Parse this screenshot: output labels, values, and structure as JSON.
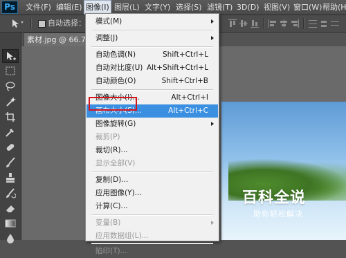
{
  "app": {
    "logo": "Ps"
  },
  "menubar": {
    "items": [
      {
        "label": "文件(F)"
      },
      {
        "label": "编辑(E)"
      },
      {
        "label": "图像(I)"
      },
      {
        "label": "图层(L)"
      },
      {
        "label": "文字(Y)"
      },
      {
        "label": "选择(S)"
      },
      {
        "label": "滤镜(T)"
      },
      {
        "label": "3D(D)"
      },
      {
        "label": "视图(V)"
      },
      {
        "label": "窗口(W)"
      },
      {
        "label": "帮助(H)"
      }
    ],
    "active_index": 2
  },
  "options_bar": {
    "auto_select_label": "自动选择："
  },
  "document": {
    "tab_label": "素材.jpg @ 66.7%"
  },
  "image_menu": {
    "items": [
      {
        "label": "模式(M)",
        "shortcut": "",
        "submenu": true,
        "disabled": false
      },
      {
        "label": "调整(J)",
        "shortcut": "",
        "submenu": true,
        "disabled": false
      },
      {
        "label": "自动色调(N)",
        "shortcut": "Shift+Ctrl+L",
        "submenu": false,
        "disabled": false
      },
      {
        "label": "自动对比度(U)",
        "shortcut": "Alt+Shift+Ctrl+L",
        "submenu": false,
        "disabled": false
      },
      {
        "label": "自动颜色(O)",
        "shortcut": "Shift+Ctrl+B",
        "submenu": false,
        "disabled": false
      },
      {
        "label": "图像大小(I)...",
        "shortcut": "Alt+Ctrl+I",
        "submenu": false,
        "disabled": false
      },
      {
        "label": "画布大小(S)...",
        "shortcut": "Alt+Ctrl+C",
        "submenu": false,
        "disabled": false,
        "highlighted": true
      },
      {
        "label": "图像旋转(G)",
        "shortcut": "",
        "submenu": true,
        "disabled": false
      },
      {
        "label": "裁剪(P)",
        "shortcut": "",
        "submenu": false,
        "disabled": true
      },
      {
        "label": "裁切(R)...",
        "shortcut": "",
        "submenu": false,
        "disabled": false
      },
      {
        "label": "显示全部(V)",
        "shortcut": "",
        "submenu": false,
        "disabled": true
      },
      {
        "label": "复制(D)...",
        "shortcut": "",
        "submenu": false,
        "disabled": false
      },
      {
        "label": "应用图像(Y)...",
        "shortcut": "",
        "submenu": false,
        "disabled": false
      },
      {
        "label": "计算(C)...",
        "shortcut": "",
        "submenu": false,
        "disabled": false
      },
      {
        "label": "变量(B)",
        "shortcut": "",
        "submenu": true,
        "disabled": true
      },
      {
        "label": "应用数据组(L)...",
        "shortcut": "",
        "submenu": false,
        "disabled": true
      },
      {
        "label": "陷印(T)...",
        "shortcut": "",
        "submenu": false,
        "disabled": true
      }
    ]
  },
  "watermark": {
    "title": "百科全说",
    "subtitle": "助你轻松解决"
  },
  "colors": {
    "highlight": "#3a8fe0",
    "annotation_box": "#d4141c"
  }
}
